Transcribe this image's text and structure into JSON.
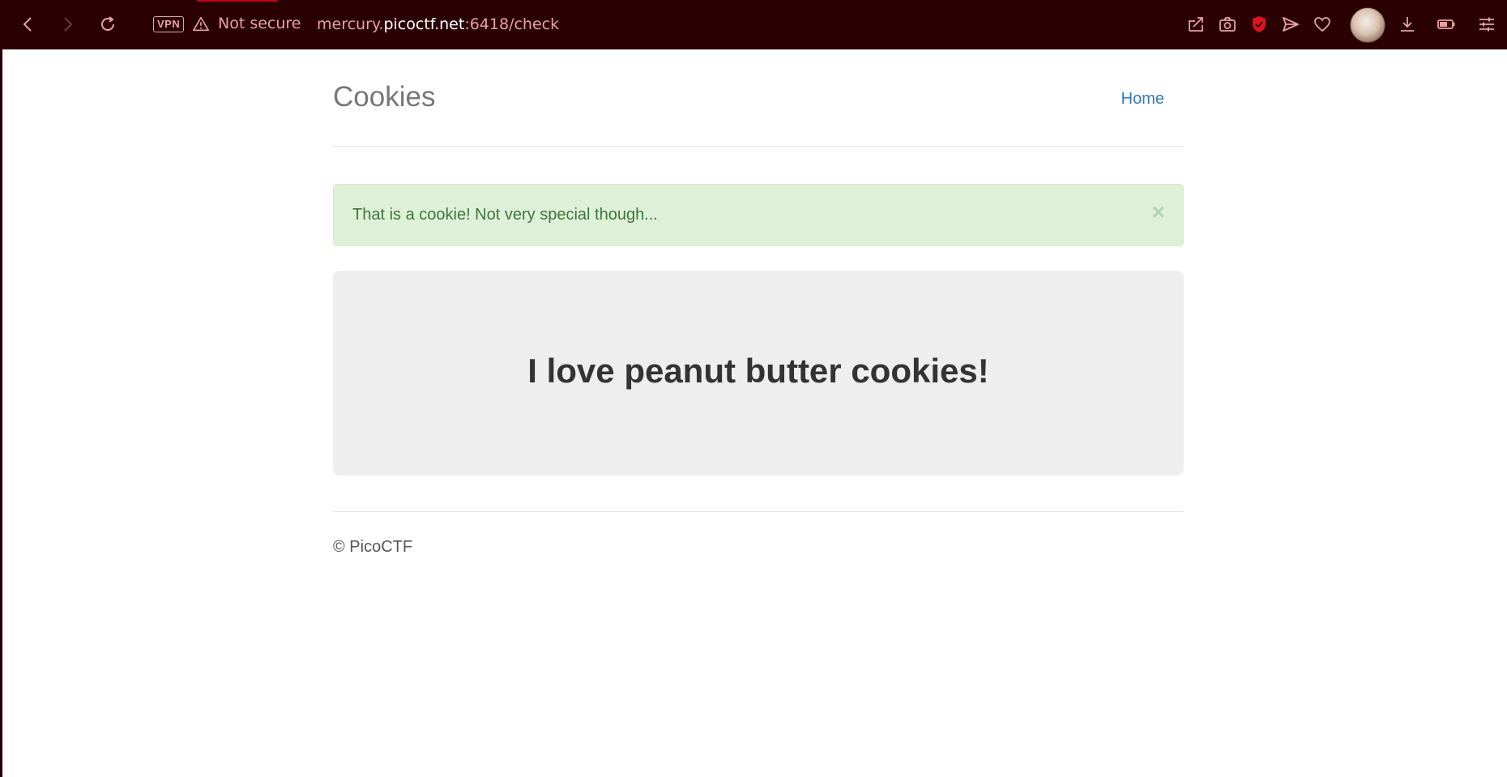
{
  "browser": {
    "vpn_label": "VPN",
    "security_text": "Not secure",
    "url_scheme_prefix": "mercury.",
    "url_host": "picoctf.net",
    "url_rest": ":6418/check",
    "accent_color": "#2a0003",
    "toolbar_icons": [
      "back-icon",
      "forward-icon",
      "reload-icon",
      "share-icon",
      "camera-icon",
      "shield-icon",
      "send-icon",
      "heart-icon",
      "avatar",
      "download-icon",
      "battery-icon",
      "settings-sliders-icon"
    ]
  },
  "page": {
    "brand": "Cookies",
    "nav": {
      "home_label": "Home"
    },
    "alert": {
      "message": "That is a cookie! Not very special though...",
      "close_symbol": "×",
      "color": "#dff0d8"
    },
    "jumbotron": {
      "heading": "I love peanut butter cookies!"
    },
    "footer": "© PicoCTF"
  }
}
